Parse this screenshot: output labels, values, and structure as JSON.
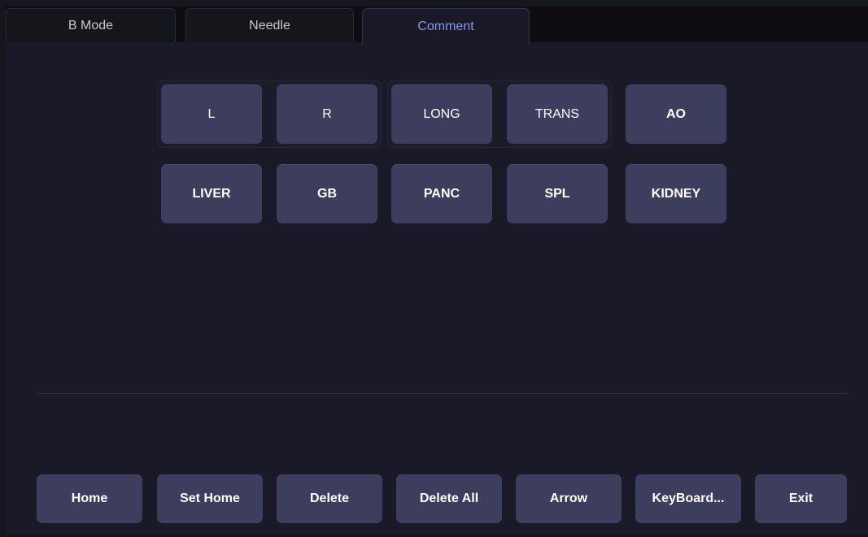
{
  "tabs": [
    {
      "label": "B Mode",
      "active": false
    },
    {
      "label": "Needle",
      "active": false
    },
    {
      "label": "Comment",
      "active": true
    }
  ],
  "comment_rows": [
    [
      "L",
      "R",
      "LONG",
      "TRANS",
      "AO"
    ],
    [
      "LIVER",
      "GB",
      "PANC",
      "SPL",
      "KIDNEY"
    ]
  ],
  "footer_buttons": [
    "Home",
    "Set Home",
    "Delete",
    "Delete All",
    "Arrow",
    "KeyBoard...",
    "Exit"
  ],
  "colors": {
    "background": "#191927",
    "tab_bar": "#0d0d12",
    "button": "#3d3d5e",
    "active_tab_text": "#8a95f0"
  }
}
